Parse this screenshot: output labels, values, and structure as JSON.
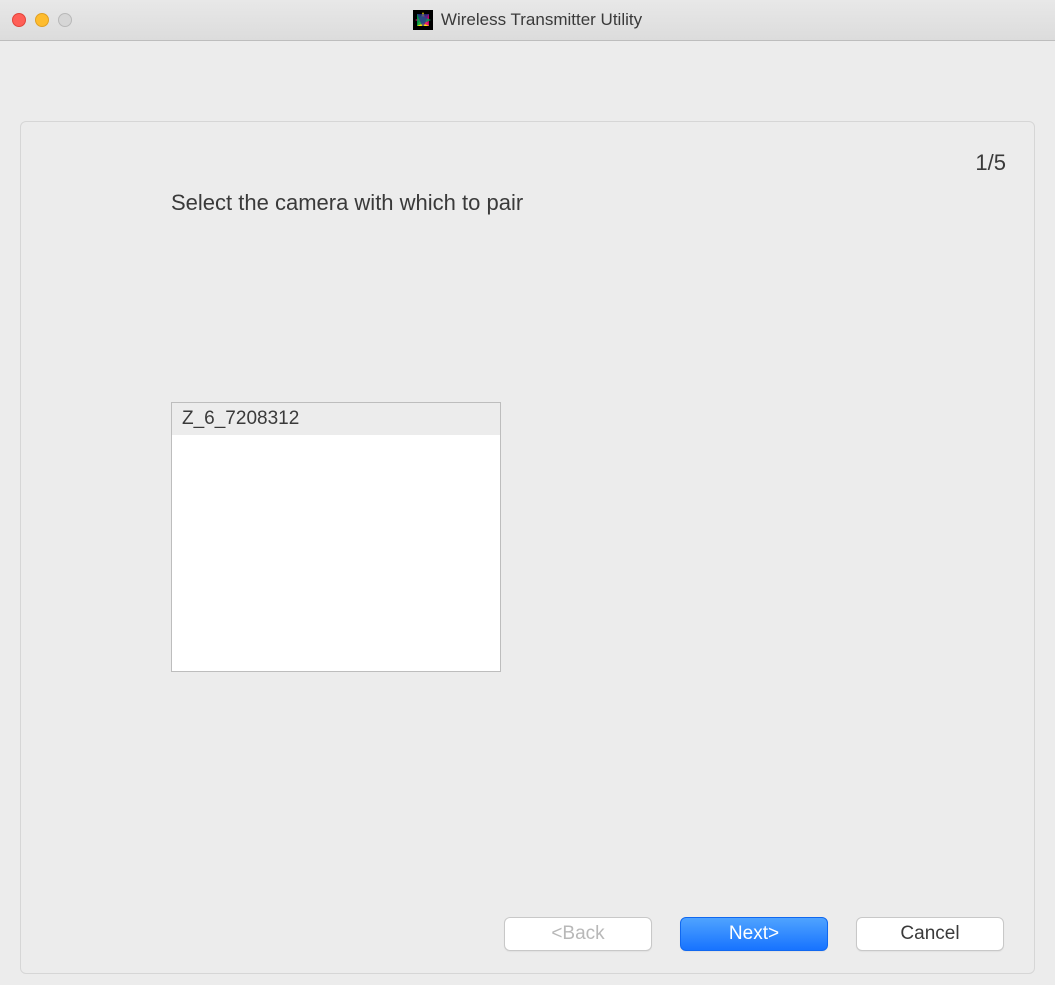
{
  "window": {
    "title": "Wireless Transmitter Utility"
  },
  "main": {
    "step_counter": "1/5",
    "instruction": "Select the camera with which to pair",
    "camera_list": {
      "items": [
        {
          "label": "Z_6_7208312",
          "selected": true
        }
      ]
    }
  },
  "footer": {
    "back_label": "<Back",
    "next_label": "Next>",
    "cancel_label": "Cancel"
  }
}
